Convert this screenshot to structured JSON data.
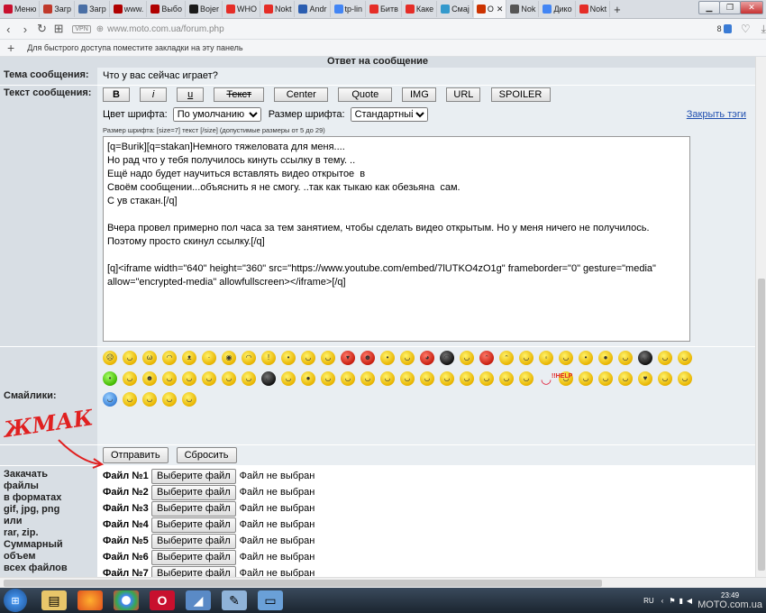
{
  "browser": {
    "tabs": [
      {
        "label": "Меню",
        "icon": "opera-icon",
        "color": "#c8102e"
      },
      {
        "label": "Загр",
        "icon": "bookmark-red-icon",
        "color": "#c0392b"
      },
      {
        "label": "Загр",
        "icon": "page-icon",
        "color": "#4a6fa5"
      },
      {
        "label": "www.",
        "icon": "site-icon",
        "color": "#b00000"
      },
      {
        "label": "Выбо",
        "icon": "site-icon",
        "color": "#b00000"
      },
      {
        "label": "Bojer",
        "icon": "n-icon",
        "color": "#1a1a1a"
      },
      {
        "label": "WHO",
        "icon": "youtube-icon",
        "color": "#e52d27"
      },
      {
        "label": "Nokt",
        "icon": "youtube-icon",
        "color": "#e52d27"
      },
      {
        "label": "Andr",
        "icon": "z-icon",
        "color": "#2a5db0"
      },
      {
        "label": "tp-lin",
        "icon": "google-icon",
        "color": "#4285f4"
      },
      {
        "label": "Битв",
        "icon": "youtube-icon",
        "color": "#e52d27"
      },
      {
        "label": "Каке",
        "icon": "youtube-icon",
        "color": "#e52d27"
      },
      {
        "label": "Смај",
        "icon": "star-icon",
        "color": "#3399cc"
      },
      {
        "label": "О",
        "icon": "moto-icon",
        "color": "#cc3300"
      },
      {
        "label": "Nok",
        "icon": "m-icon",
        "color": "#555555"
      },
      {
        "label": "Дико",
        "icon": "google-icon",
        "color": "#4285f4"
      },
      {
        "label": "Nokt",
        "icon": "youtube-icon",
        "color": "#e52d27"
      }
    ],
    "url": "www.moto.com.ua/forum.php",
    "vpn": "VPN",
    "badge": "8",
    "bookmarks_hint": "Для быстрого доступа поместите закладки на эту панель"
  },
  "form": {
    "section_title": "Ответ на сообщение",
    "subject_label": "Тема сообщения:",
    "subject_value": "Что у вас сейчас играет?",
    "text_label": "Текст сообщения:",
    "toolbar": {
      "bold": "B",
      "italic": "i",
      "underline": "u",
      "strike": "Текст",
      "center": "Center",
      "quote": "Quote",
      "img": "IMG",
      "url": "URL",
      "spoiler": "SPOILER"
    },
    "font_color_label": "Цвет шрифта:",
    "font_color_value": "По умолчанию",
    "font_size_label": "Размер шрифта:",
    "font_size_value": "Стандартный",
    "close_tags": "Закрыть тэги",
    "size_hint": "Размер шрифта: [size=7] текст [/size] (допустимые размеры от 5 до 29)",
    "message": "[q=Burik][q=stakan]Немного тяжеловата для меня....\nНо рад что у тебя получилось кинуть ссылку в тему. ..\nЕщё надо будет научиться вставлять видео открытое  в\nСвоём сообщении...объяснить я не смогу. ..так как тыкаю как обезьяна  сам.\nС ув стакан.[/q]\n\nВчера провел примерно пол часа за тем занятием, чтобы сделать видео открытым. Но у меня ничего не получилось.\nПоэтому просто скинул ссылку.[/q]\n\n[q]<iframe width=\"640\" height=\"360\" src=\"https://www.youtube.com/embed/7lUTKO4zO1g\" frameborder=\"0\" gesture=\"media\" allow=\"encrypted-media\" allowfullscreen></iframe>[/q]",
    "smilies_label": "Смайлики:",
    "help_badge": "!!HELP",
    "submit": "Отправить",
    "reset": "Сбросить",
    "upload_label_lines": [
      "Закачать",
      "файлы",
      "в форматах",
      "gif, jpg, png",
      "или",
      "rar, zip.",
      "Суммарный объем",
      "всех файлов"
    ],
    "file_button": "Выберите файл",
    "file_status": "Файл не выбран",
    "files": [
      "Файл №1",
      "Файл №2",
      "Файл №3",
      "Файл №4",
      "Файл №5",
      "Файл №6",
      "Файл №7"
    ]
  },
  "annotation": {
    "scribble": "ЖМАК",
    "color": "#e02020"
  },
  "taskbar": {
    "lang": "RU",
    "time": "23:49",
    "watermark": "MOTO.com.ua"
  }
}
